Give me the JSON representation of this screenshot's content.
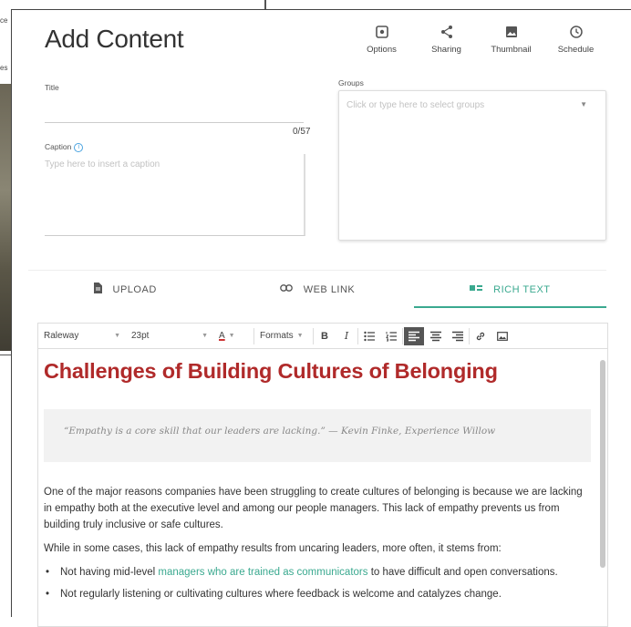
{
  "background": {
    "text_lines": [
      "ce",
      "es"
    ]
  },
  "header": {
    "title": "Add Content",
    "tools": [
      {
        "icon": "options-icon",
        "label": "Options"
      },
      {
        "icon": "share-icon",
        "label": "Sharing"
      },
      {
        "icon": "image-icon",
        "label": "Thumbnail"
      },
      {
        "icon": "clock-icon",
        "label": "Schedule"
      }
    ]
  },
  "form": {
    "title_label": "Title",
    "title_counter": "0/57",
    "caption_label": "Caption",
    "caption_info": "i",
    "caption_placeholder": "Type here to insert a caption",
    "groups_label": "Groups",
    "groups_placeholder": "Click or type here to select groups",
    "groups_caret": "▼"
  },
  "tabs": [
    {
      "icon": "file-icon",
      "label": "UPLOAD",
      "active": false
    },
    {
      "icon": "link-icon",
      "label": "WEB LINK",
      "active": false
    },
    {
      "icon": "rich-text-icon",
      "label": "RICH TEXT",
      "active": true
    }
  ],
  "editor": {
    "font_family": "Raleway",
    "font_size": "23pt",
    "font_color_label": "A",
    "formats_label": "Formats",
    "bold": "B",
    "italic": "I"
  },
  "document": {
    "heading": "Challenges of Building Cultures of Belonging",
    "quote": "“Empathy is a core skill that our leaders are lacking.” — Kevin Finke, Experience Willow",
    "para1": "One of the major reasons companies have been struggling to create cultures of belonging is because we are lacking in empathy both at the executive level and among our people managers. This lack of empathy prevents us from building truly inclusive or safe cultures.",
    "para2": "While in some cases, this lack of empathy results from uncaring leaders, more often, it stems from:",
    "bullet1_before": "Not having mid-level ",
    "bullet1_link": "managers who are trained as communicators",
    "bullet1_after": " to have difficult and open conversations.",
    "bullet2": "Not regularly listening or cultivating cultures where feedback is welcome and catalyzes change."
  },
  "colors": {
    "accent": "#3aa98f",
    "heading": "#b02a2a"
  }
}
